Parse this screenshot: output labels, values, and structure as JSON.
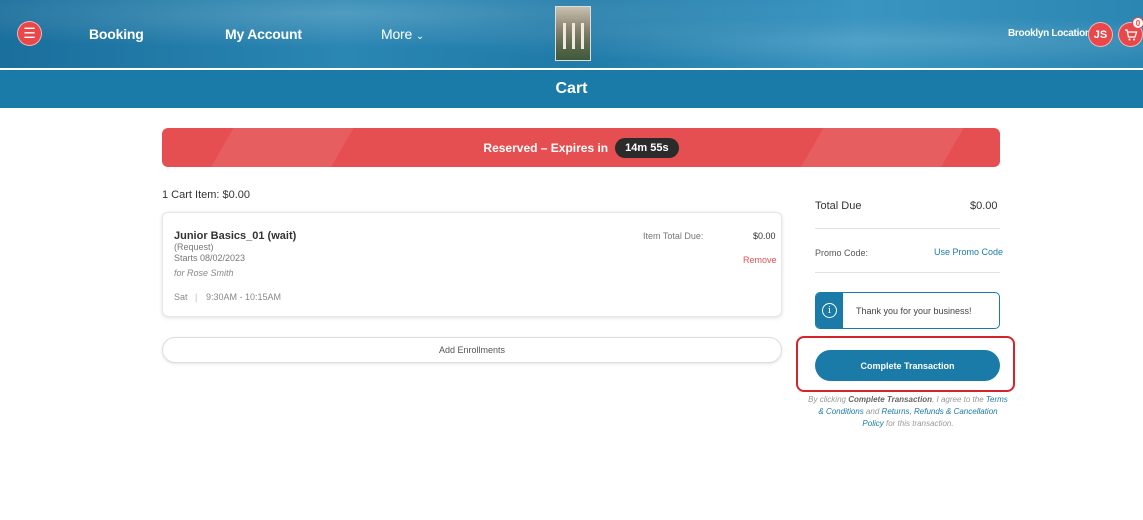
{
  "nav": {
    "menu_icon": "hamburger-icon",
    "booking": "Booking",
    "my_account": "My Account",
    "more": "More",
    "more_icon": "chevron-down-icon",
    "location": "Brooklyn Location",
    "avatar_initials": "JS",
    "cart_icon": "cart-icon",
    "cart_badge": "0"
  },
  "page_title": "Cart",
  "banner": {
    "label": "Reserved – Expires in",
    "timer": "14m 55s"
  },
  "cart": {
    "count_label": "1 Cart Item: $0.00",
    "items": [
      {
        "name": "Junior Basics_01 (wait)",
        "type": "(Request)",
        "starts": "Starts 08/02/2023",
        "for": "for Rose Smith",
        "day": "Sat",
        "time": "9:30AM - 10:15AM",
        "total_label": "Item Total Due:",
        "total_value": "$0.00",
        "remove": "Remove"
      }
    ],
    "add_enrollments": "Add Enrollments"
  },
  "summary": {
    "total_label": "Total Due",
    "total_value": "$0.00",
    "promo_label": "Promo Code:",
    "promo_link": "Use Promo Code",
    "info_icon": "info-icon",
    "info_text": "Thank you for your business!",
    "complete_button": "Complete Transaction"
  },
  "legal": {
    "prefix": "By clicking ",
    "button_ref": "Complete Transaction",
    "middle": ", I agree to the ",
    "terms": "Terms & Conditions",
    "and": " and ",
    "refunds": "Returns, Refunds & Cancellation Policy",
    "suffix": " for this transaction."
  },
  "colors": {
    "brand_blue": "#1a7aa8",
    "accent_red": "#e54f52",
    "highlight_red": "#d6252a"
  }
}
